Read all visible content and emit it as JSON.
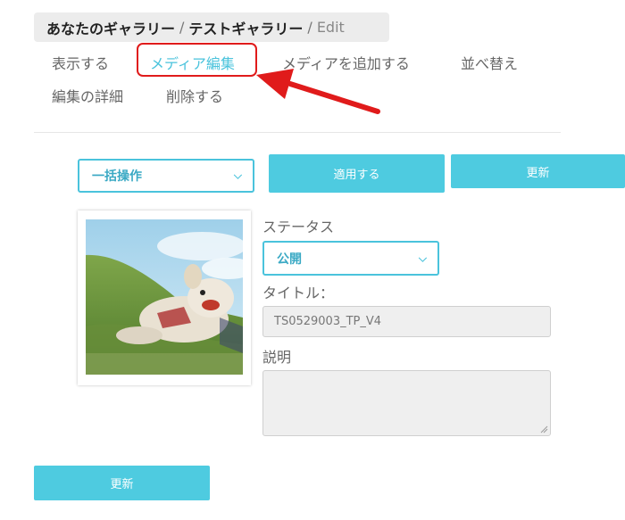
{
  "breadcrumb": {
    "gallery_root": "あなたのギャラリー",
    "separator": "/",
    "gallery_name": "テストギャラリー",
    "current": "Edit"
  },
  "tabs": [
    {
      "label": "表示する",
      "active": false
    },
    {
      "label": "メディア編集",
      "active": true
    },
    {
      "label": "メディアを追加する",
      "active": false
    },
    {
      "label": "並べ替え",
      "active": false
    },
    {
      "label": "編集の詳細",
      "active": false
    },
    {
      "label": "削除する",
      "active": false
    }
  ],
  "bulk": {
    "select_value": "一括操作",
    "apply_label": "適用する",
    "update_label": "更新"
  },
  "media_item": {
    "image_subject": "dog-on-grass-photo",
    "status_label": "ステータス",
    "status_value": "公開",
    "title_label": "タイトル：",
    "title_value": "TS0529003_TP_V4",
    "description_label": "説明",
    "description_value": ""
  },
  "footer": {
    "update_label": "更新"
  },
  "colors": {
    "accent": "#4ecbe0",
    "highlight": "#e01b1b"
  },
  "icons": {
    "dropdown": "chevron-down-icon",
    "annotation_arrow": "red-arrow-icon"
  }
}
